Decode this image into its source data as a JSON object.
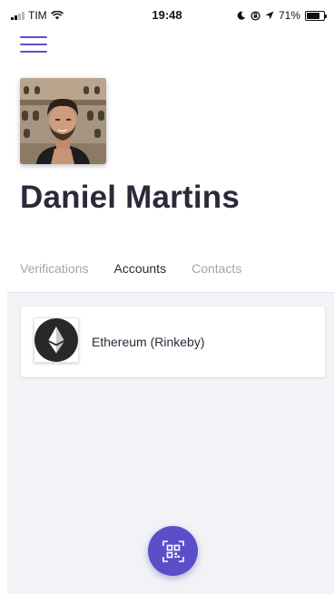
{
  "status_bar": {
    "carrier": "TIM",
    "time": "19:48",
    "battery": "71%",
    "battery_level": 0.71
  },
  "profile": {
    "name": "Daniel Martins"
  },
  "tabs": [
    {
      "label": "Verifications",
      "active": false
    },
    {
      "label": "Accounts",
      "active": true
    },
    {
      "label": "Contacts",
      "active": false
    }
  ],
  "accounts": [
    {
      "label": "Ethereum (Rinkeby)",
      "icon": "ethereum-icon"
    }
  ],
  "colors": {
    "accent": "#5b4fc9",
    "text": "#2b2a3a",
    "muted": "#a3a3ad",
    "background": "#f3f3f7"
  },
  "icons": {
    "menu": "hamburger-icon",
    "qr": "qr-code-icon"
  }
}
